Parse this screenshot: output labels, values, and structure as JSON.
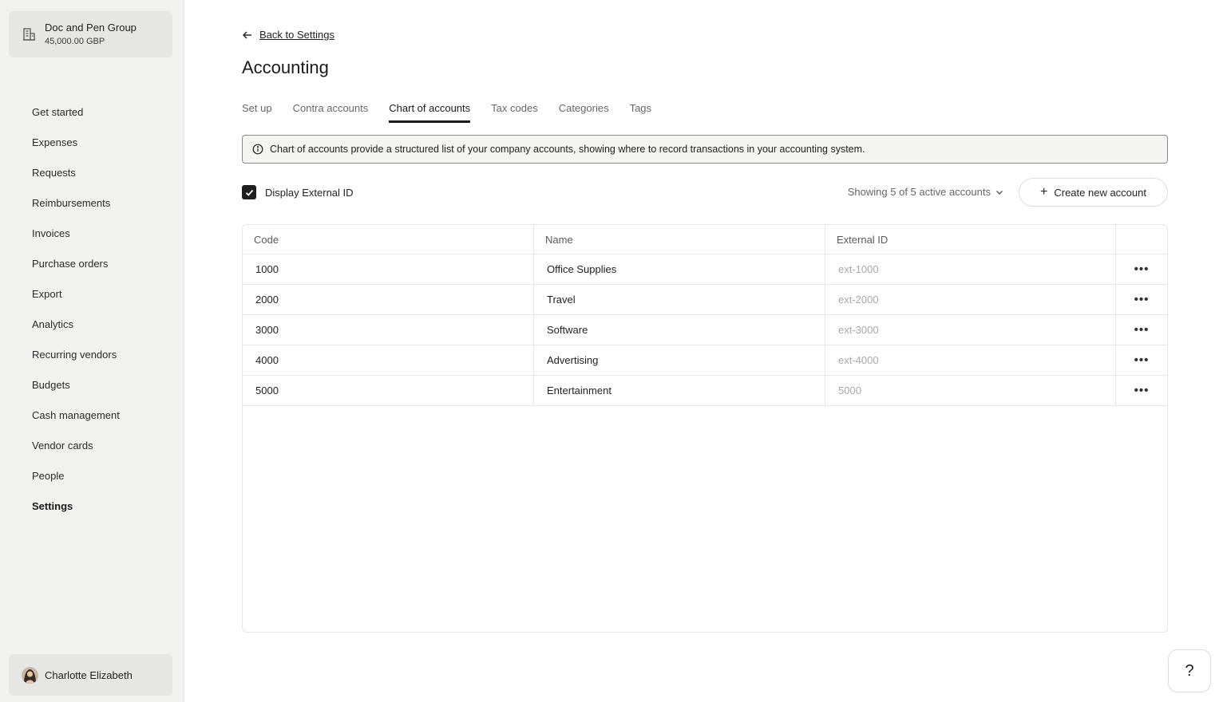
{
  "org": {
    "name": "Doc and Pen Group",
    "balance": "45,000.00 GBP"
  },
  "nav": {
    "items": [
      {
        "label": "Get started"
      },
      {
        "label": "Expenses"
      },
      {
        "label": "Requests"
      },
      {
        "label": "Reimbursements"
      },
      {
        "label": "Invoices"
      },
      {
        "label": "Purchase orders"
      },
      {
        "label": "Export"
      },
      {
        "label": "Analytics"
      },
      {
        "label": "Recurring vendors"
      },
      {
        "label": "Budgets"
      },
      {
        "label": "Cash management"
      },
      {
        "label": "Vendor cards"
      },
      {
        "label": "People"
      },
      {
        "label": "Settings",
        "active": true
      }
    ]
  },
  "user": {
    "name": "Charlotte Elizabeth"
  },
  "header": {
    "back_label": "Back to Settings",
    "title": "Accounting"
  },
  "tabs": [
    {
      "label": "Set up"
    },
    {
      "label": "Contra accounts"
    },
    {
      "label": "Chart of accounts",
      "active": true
    },
    {
      "label": "Tax codes"
    },
    {
      "label": "Categories"
    },
    {
      "label": "Tags"
    }
  ],
  "banner": {
    "text": "Chart of accounts provide a structured list of your company accounts, showing where to record transactions in your accounting system."
  },
  "controls": {
    "display_external_id_label": "Display External ID",
    "display_external_id_checked": true,
    "showing_text": "Showing 5 of 5 active accounts",
    "create_label": "Create new account"
  },
  "table": {
    "headers": {
      "code": "Code",
      "name": "Name",
      "external_id": "External ID"
    },
    "rows": [
      {
        "code": "1000",
        "name": "Office Supplies",
        "external_id": "ext-1000"
      },
      {
        "code": "2000",
        "name": "Travel",
        "external_id": "ext-2000"
      },
      {
        "code": "3000",
        "name": "Software",
        "external_id": "ext-3000"
      },
      {
        "code": "4000",
        "name": "Advertising",
        "external_id": "ext-4000"
      },
      {
        "code": "5000",
        "name": "Entertainment",
        "external_id": "5000"
      }
    ],
    "row_action_glyph": "•••"
  },
  "help": {
    "label": "?"
  }
}
